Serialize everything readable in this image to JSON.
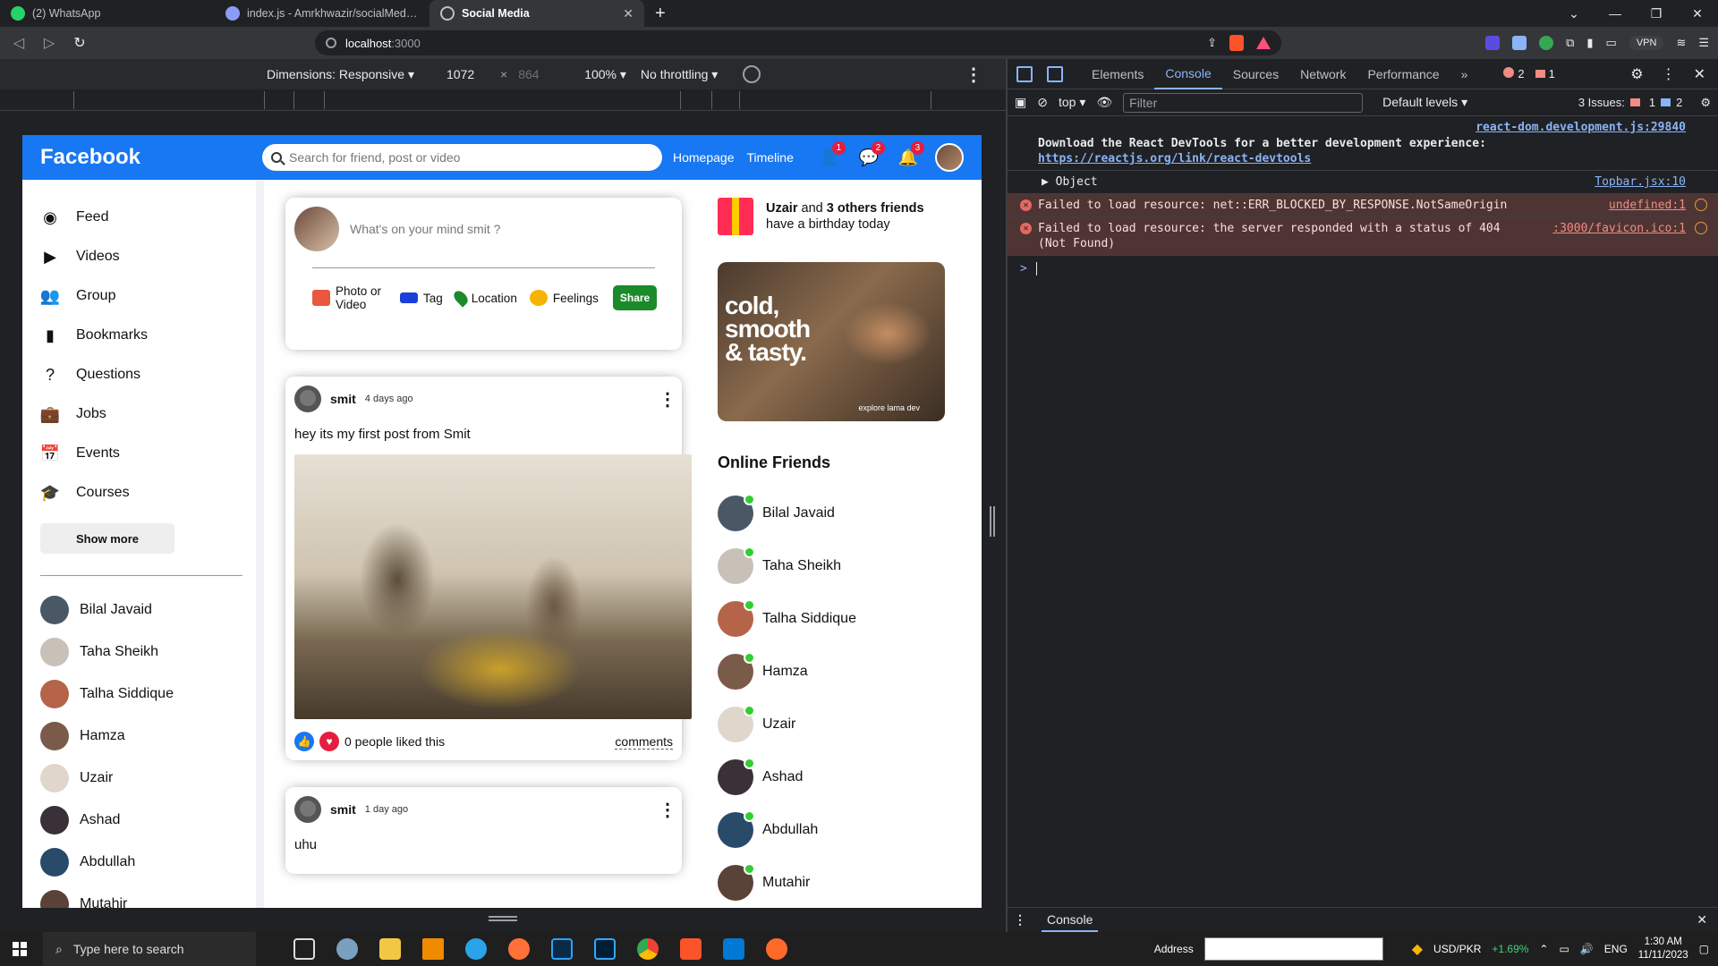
{
  "browser": {
    "tabs": [
      {
        "title": "(2) WhatsApp",
        "icon": "whatsapp-icon",
        "active": false
      },
      {
        "title": "index.js - Amrkhwazir/socialMedia-Fu",
        "icon": "github-icon",
        "active": false
      },
      {
        "title": "Social Media",
        "icon": "globe-icon",
        "active": true
      }
    ],
    "new_tab": "+",
    "url_host": "localhost",
    "url_port": ":3000",
    "vpn_label": "VPN"
  },
  "device_toolbar": {
    "dimensions": "Dimensions: Responsive ▾",
    "width": "1072",
    "x": "×",
    "height": "864",
    "zoom": "100% ▾",
    "throttling": "No throttling ▾"
  },
  "app": {
    "logo": "Facebook",
    "search_placeholder": "Search for friend, post or video",
    "links": [
      "Homepage",
      "Timeline"
    ],
    "badges": {
      "friends": "1",
      "messages": "2",
      "notifications": "3"
    },
    "sidebar": [
      {
        "label": "Feed",
        "icon": "rss-icon"
      },
      {
        "label": "Videos",
        "icon": "play-circle-icon"
      },
      {
        "label": "Group",
        "icon": "group-icon"
      },
      {
        "label": "Bookmarks",
        "icon": "bookmark-icon"
      },
      {
        "label": "Questions",
        "icon": "help-icon"
      },
      {
        "label": "Jobs",
        "icon": "work-icon"
      },
      {
        "label": "Events",
        "icon": "event-icon"
      },
      {
        "label": "Courses",
        "icon": "school-icon"
      }
    ],
    "show_more": "Show more",
    "sidebar_friends": [
      "Bilal Javaid",
      "Taha Sheikh",
      "Talha Siddique",
      "Hamza",
      "Uzair",
      "Ashad",
      "Abdullah",
      "Mutahir"
    ],
    "share": {
      "placeholder": "What's on your mind smit ?",
      "options": [
        "Photo or Video",
        "Tag",
        "Location",
        "Feelings"
      ],
      "button": "Share"
    },
    "posts": [
      {
        "user": "smit",
        "date": "4 days ago",
        "text": "hey its my first post from Smit",
        "likes": "0 people liked this",
        "comments": "comments"
      },
      {
        "user": "smit",
        "date": "1 day ago",
        "text": "uhu"
      }
    ],
    "birthday": {
      "name": "Uzair",
      "and": "and",
      "others": "3 others friends",
      "rest": "have a birthday today"
    },
    "ad": {
      "headline": "cold, smooth & tasty.",
      "tagline": "explore lama dev"
    },
    "online_title": "Online Friends",
    "online_friends": [
      "Bilal Javaid",
      "Taha Sheikh",
      "Talha Siddique",
      "Hamza",
      "Uzair",
      "Ashad",
      "Abdullah",
      "Mutahir"
    ]
  },
  "devtools": {
    "tabs": [
      "Elements",
      "Console",
      "Sources",
      "Network",
      "Performance",
      "»"
    ],
    "error_count": "2",
    "issue_count": "1",
    "context": "top ▾",
    "filter_placeholder": "Filter",
    "levels": "Default levels ▾",
    "issues_label": "3 Issues:",
    "issues_red": "1",
    "issues_blue": "2",
    "messages": [
      {
        "type": "info",
        "source": "react-dom.development.js:29840",
        "text": "Download the React DevTools for a better development experience: ",
        "link": "https://reactjs.org/link/react-devtools"
      },
      {
        "type": "log",
        "source": "Topbar.jsx:10",
        "text": "▶ Object"
      },
      {
        "type": "error",
        "source": "undefined:1",
        "text": "Failed to load resource: net::ERR_BLOCKED_BY_RESPONSE.NotSameOrigin"
      },
      {
        "type": "error",
        "source": ":3000/favicon.ico:1",
        "text": "Failed to load resource: the server responded with a status of 404 (Not Found)"
      }
    ],
    "prompt": ">",
    "drawer_tab": "Console"
  },
  "taskbar": {
    "search_placeholder": "Type here to search",
    "address_label": "Address",
    "currency": "USD/PKR",
    "change": "+1.69%",
    "lang": "ENG",
    "time": "1:30 AM",
    "date": "11/11/2023"
  },
  "colors": {
    "brand": "#1877f2",
    "online": "#32cd32",
    "share": "#1b8a2a",
    "error_bg": "#4e3534"
  }
}
